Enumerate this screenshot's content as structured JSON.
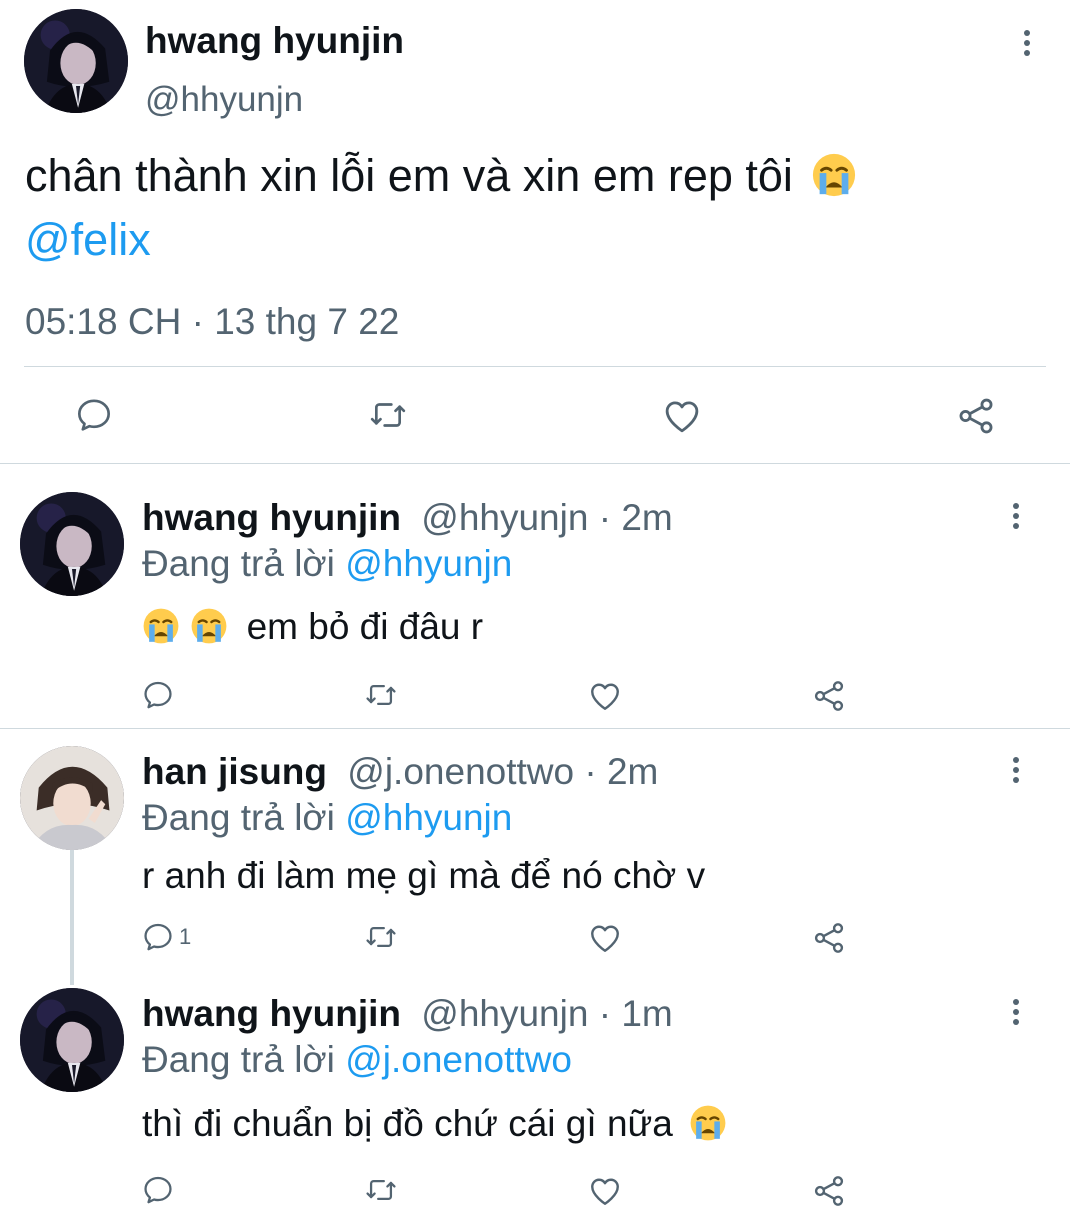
{
  "main_tweet": {
    "author_name": "hwang hyunjin",
    "author_handle": "@hhyunjn",
    "text": "chân thành xin lỗi em và xin em rep tôi",
    "text_emoji": "loudly-crying-face",
    "mention": "@felix",
    "timestamp": "05:18 CH · 13 thg 7 22",
    "actions": [
      "reply-icon",
      "retweet-icon",
      "like-icon",
      "share-icon"
    ]
  },
  "replies": [
    {
      "author_name": "hwang hyunjin",
      "author_handle": "@hhyunjn",
      "time": "· 2m",
      "replying_prefix": "Đang trả lời",
      "replying_to": "@hhyunjn",
      "text": "em bỏ đi đâu r",
      "leading_emojis": [
        "loudly-crying-face",
        "loudly-crying-face"
      ],
      "reply_count": ""
    },
    {
      "author_name": "han jisung",
      "author_handle": "@j.onenottwo",
      "time": "· 2m",
      "replying_prefix": "Đang trả lời",
      "replying_to": "@hhyunjn",
      "text": "r anh đi làm mẹ gì mà để nó chờ v",
      "reply_count": "1"
    },
    {
      "author_name": "hwang hyunjin",
      "author_handle": "@hhyunjn",
      "time": "· 1m",
      "replying_prefix": "Đang trả lời",
      "replying_to": "@j.onenottwo",
      "text": "thì đi chuẩn bị đồ chứ cái gì nữa",
      "trailing_emoji": "loudly-crying-face",
      "reply_count": ""
    }
  ],
  "colors": {
    "link": "#1d9bf0",
    "muted": "#536471",
    "text": "#0f1419",
    "divider": "#cfd9de"
  }
}
